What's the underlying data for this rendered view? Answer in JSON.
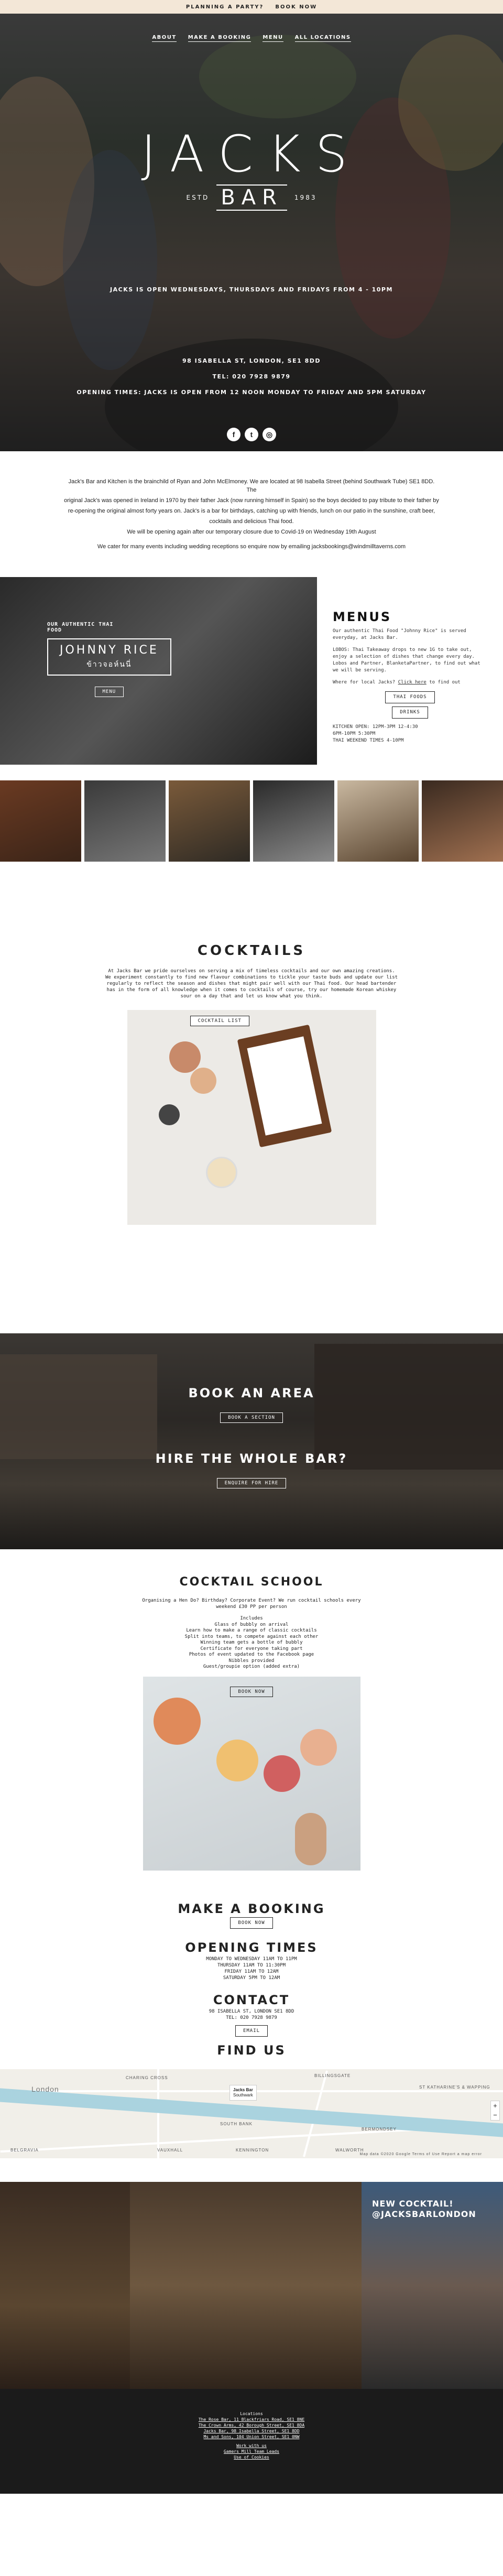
{
  "topbar": {
    "planning": "PLANNING A PARTY?",
    "book": "BOOK NOW",
    "bg": "#f3e7d7"
  },
  "nav": {
    "items": [
      "ABOUT",
      "MAKE A BOOKING",
      "MENU",
      "ALL LOCATIONS"
    ]
  },
  "logo": {
    "name": "JACKS",
    "estd": "ESTD",
    "bar": "BAR",
    "year": "1983"
  },
  "hero": {
    "open_days": "JACKS IS OPEN WEDNESDAYS, THURSDAYS AND FRIDAYS FROM 4 - 10PM",
    "address": "98 ISABELLA ST, LONDON, SE1 8DD",
    "tel": "TEL: 020 7928 9879",
    "opening": "OPENING TIMES: JACKS IS OPEN FROM 12 NOON MONDAY TO FRIDAY AND 5PM SATURDAY"
  },
  "social": {
    "icons": [
      "facebook-icon",
      "twitter-icon",
      "instagram-icon"
    ],
    "glyphs": [
      "f",
      "t",
      "◎"
    ]
  },
  "intro": {
    "lines": [
      "Jack's Bar and Kitchen is the brainchild of Ryan and John McElmoney. We are located at 98 Isabella Street (behind Southwark Tube) SE1 8DD. The",
      "original Jack's was opened in Ireland in 1970 by their father Jack (now running himself in Spain) so the boys decided to pay tribute to their father by",
      "re-opening the original almost forty years on. Jack's is a bar for birthdays, catching up with friends, lunch on our patio in the sunshine, craft beer,",
      "cocktails and delicious Thai food.",
      "We will be opening again after our temporary closure due to Covid-19 on Wednesday 19th August"
    ],
    "events": "We cater for many events including wedding receptions so enquire now by emailing jacksbookings@windmilltaverns.com"
  },
  "menus": {
    "tag1": "OUR AUTHENTIC THAI",
    "tag2": "FOOD",
    "brand": "JOHNNY RICE",
    "thai": "ข้าวจอห์นนี่",
    "photo_btn": "MENU",
    "title": "MENUS",
    "p1": "Our authentic Thai Food \"Johnny Rice\" is served everyday, at Jacks Bar.",
    "p2": "LOBOS: Thai Takeaway drops to new 1G to take out, enjoy a selection of dishes that change every day. Lobos and Partner, BlanketaPartner, to find out what we will be serving.",
    "p3a": "Where for local Jacks? ",
    "p3_link": "Click here",
    "p3b": " to find out",
    "btn1": "THAI FOODS",
    "btn2": "DRINKS",
    "hours1": "KITCHEN OPEN: 12PM-3PM 12-4:30",
    "hours2": "6PM-10PM 5:30PM",
    "hours3": "THAI WEEKEND TIMES 4-10PM"
  },
  "cocktails": {
    "title": "COCKTAILS",
    "desc": "At Jacks Bar we pride ourselves on serving a mix of timeless cocktails and our own amazing creations. We experiment constantly to find new flavour combinations to tickle your taste buds and update our list regularly to reflect the season and dishes that might pair well with our Thai food. Our head bartender has in the form of all knowledge when it comes to cocktails of course, try our homemade Korean whiskey sour on a day that and let us know what you think.",
    "btn": "COCKTAIL LIST"
  },
  "area": {
    "book_title": "BOOK AN AREA",
    "book_btn": "BOOK A SECTION",
    "hire_title": "HIRE THE WHOLE BAR?",
    "hire_btn": "ENQUIRE FOR HIRE"
  },
  "school": {
    "title": "COCKTAIL SCHOOL",
    "lines": [
      "Organising a Hen Do? Birthday? Corporate Event? We run cocktail schools every",
      "weekend £30 PP per person",
      "",
      "Includes",
      "Glass of bubbly on arrival",
      "Learn how to make a range of classic cocktails",
      "Split into teams, to compete against each other",
      "Winning team gets a bottle of bubbly",
      "Certificate for everyone taking part",
      "Photos of event updated to the Facebook page",
      "Nibbles provided",
      "Guest/groupie option (added extra)"
    ],
    "btn": "BOOK NOW"
  },
  "booking": {
    "title": "MAKE A BOOKING",
    "btn": "BOOK NOW"
  },
  "times": {
    "title": "OPENING TIMES",
    "lines": [
      "MONDAY TO WEDNESDAY 11AM TO 11PM",
      "THURSDAY 11AM TO 11:30PM",
      "FRIDAY 11AM TO 12AM",
      "SATURDAY 5PM TO 12AM"
    ]
  },
  "contact": {
    "title": "CONTACT",
    "address": "98 ISABELLA ST, LONDON SE1 8DD",
    "tel": "TEL: 020 7928 9879",
    "btn": "EMAIL"
  },
  "find": {
    "title": "FIND US"
  },
  "map": {
    "labels": [
      "SOUTH BANK",
      "London",
      "KENNINGTON",
      "BERMONDSEY",
      "VAUXHALL",
      "CHARING CROSS",
      "BILLINGSGATE",
      "ST KATHARINE'S & WAPPING",
      "BELGRAVIA",
      "WALWORTH"
    ],
    "pin_name": "Jacks Bar",
    "pin_sub": "Southwark",
    "zoom_in": "+",
    "zoom_out": "−",
    "credit": "Map data ©2020 Google  Terms of Use  Report a map error"
  },
  "photo3": {
    "line1": "NEW COCKTAIL!",
    "line2": "@JACKSBARLONDON"
  },
  "footer": {
    "heading": "Locations",
    "locations": [
      "The Rose Bar, 11 Blackfriars Road, SE1 8NE",
      "The Crown Arms, 42 Borough Street, SE1 8DA",
      "Jacks Bar, 98 Isabella Street, SE1 8DD",
      "Ms and Sons, 104 Union Street, SE1 0NW"
    ],
    "work": "Work with us",
    "dev": "Gamers Mill Team Leads",
    "terms": "Use of Cookies"
  }
}
